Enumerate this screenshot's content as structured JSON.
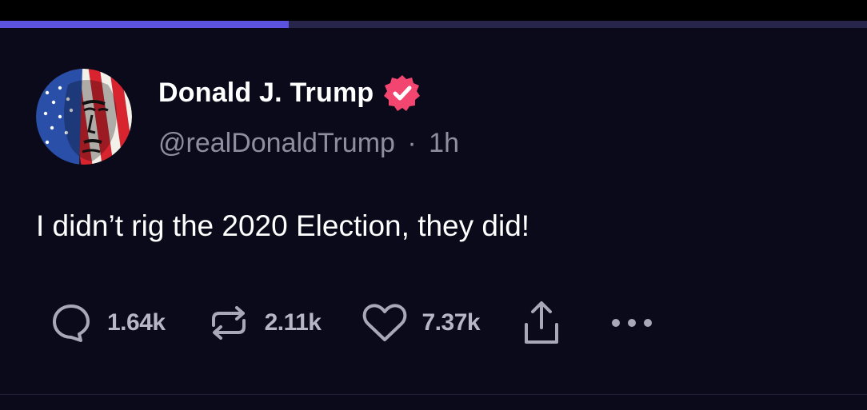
{
  "story_progress": {
    "fraction": 0.333,
    "fill_color": "#5b52e0",
    "track_color": "#27264a"
  },
  "post": {
    "author": {
      "display_name": "Donald J. Trump",
      "handle": "@realDonaldTrump",
      "verified": true,
      "verified_color": "#f2456f",
      "avatar_icon": "flag-portrait-avatar"
    },
    "separator": "·",
    "time": "1h",
    "text": "I didn’t rig the 2020 Election, they did!",
    "actions": {
      "replies": {
        "icon": "reply-icon",
        "count": "1.64k"
      },
      "reposts": {
        "icon": "repost-icon",
        "count": "2.11k"
      },
      "likes": {
        "icon": "heart-icon",
        "count": "7.37k"
      },
      "share": {
        "icon": "share-icon"
      },
      "more": {
        "icon": "more-icon"
      }
    }
  },
  "colors": {
    "background": "#0b0a1a",
    "text_primary": "#ffffff",
    "text_secondary": "#8f8ea0",
    "icon": "#a9a8b8"
  }
}
